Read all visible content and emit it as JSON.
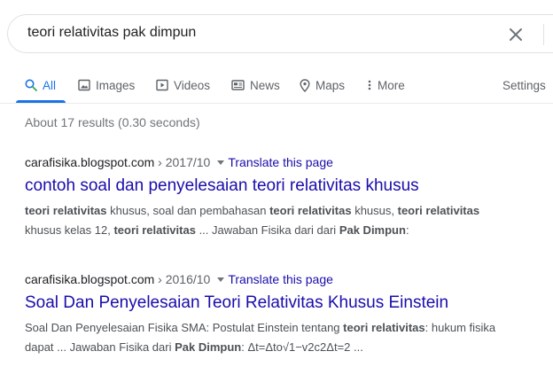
{
  "search": {
    "query": "teori relativitas pak dimpun"
  },
  "tabs": {
    "all": "All",
    "images": "Images",
    "videos": "Videos",
    "news": "News",
    "maps": "Maps",
    "more": "More",
    "settings": "Settings"
  },
  "stats": "About 17 results (0.30 seconds)",
  "results": [
    {
      "domain": "carafisika.blogspot.com",
      "path": " › 2017/10",
      "translate": "Translate this page",
      "title": "contoh soal dan penyelesaian teori relativitas khusus",
      "snippet_line1": [
        {
          "t": "teori relativitas",
          "b": true
        },
        {
          "t": " khusus, soal dan pembahasan ",
          "b": false
        },
        {
          "t": "teori relativitas",
          "b": true
        },
        {
          "t": " khusus, ",
          "b": false
        },
        {
          "t": "teori relativitas",
          "b": true
        }
      ],
      "snippet_line2": [
        {
          "t": "khusus kelas 12, ",
          "b": false
        },
        {
          "t": "teori relativitas",
          "b": true
        },
        {
          "t": " ... Jawaban Fisika dari dari ",
          "b": false
        },
        {
          "t": "Pak Dimpun",
          "b": true
        },
        {
          "t": ":",
          "b": false
        }
      ]
    },
    {
      "domain": "carafisika.blogspot.com",
      "path": " › 2016/10",
      "translate": "Translate this page",
      "title": "Soal Dan Penyelesaian Teori Relativitas Khusus Einstein",
      "snippet_line1": [
        {
          "t": "Soal Dan Penyelesaian Fisika SMA: Postulat Einstein tentang ",
          "b": false
        },
        {
          "t": "teori relativitas",
          "b": true
        },
        {
          "t": ": hukum fisika",
          "b": false
        }
      ],
      "snippet_line2": [
        {
          "t": "dapat ... Jawaban Fisika dari ",
          "b": false
        },
        {
          "t": "Pak Dimpun",
          "b": true
        },
        {
          "t": ": Δt=Δto√1−v2c2Δt=2 ...",
          "b": false
        }
      ]
    }
  ],
  "colors": {
    "accent": "#1a73e8",
    "link": "#1a0dab",
    "muted": "#70757a"
  },
  "icons": [
    "search-icon",
    "image-icon",
    "video-icon",
    "news-icon",
    "map-pin-icon",
    "more-dots-icon",
    "close-icon"
  ]
}
